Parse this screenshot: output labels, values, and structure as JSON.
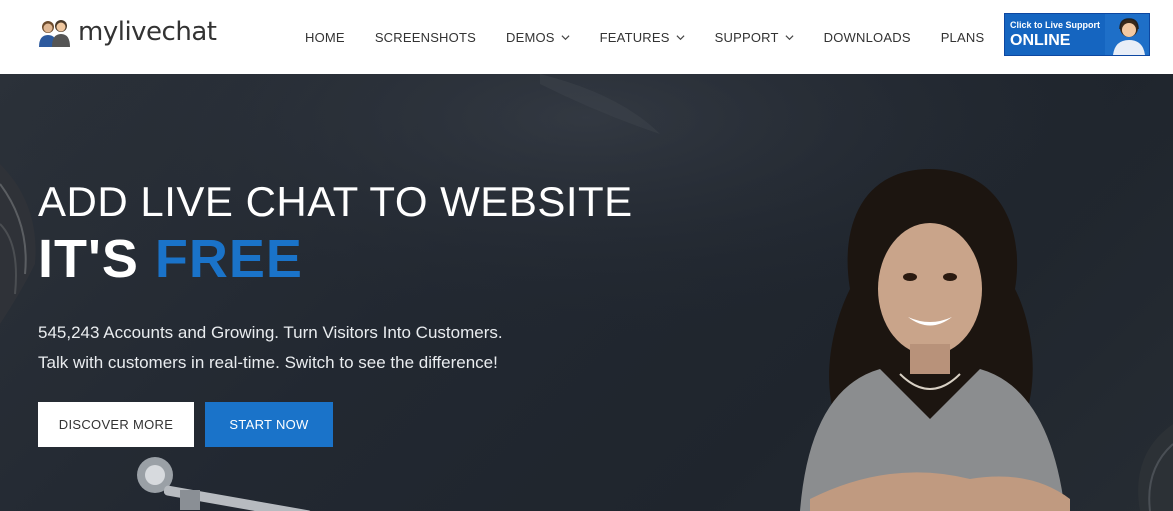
{
  "nav": {
    "logo_text": "mylivechat",
    "items": [
      {
        "label": "HOME",
        "has_dropdown": false
      },
      {
        "label": "SCREENSHOTS",
        "has_dropdown": false
      },
      {
        "label": "DEMOS",
        "has_dropdown": true
      },
      {
        "label": "FEATURES",
        "has_dropdown": true
      },
      {
        "label": "SUPPORT",
        "has_dropdown": true
      },
      {
        "label": "DOWNLOADS",
        "has_dropdown": false
      },
      {
        "label": "PLANS",
        "has_dropdown": false
      }
    ],
    "support_badge": {
      "line1": "Click to Live Support",
      "line2": "ONLINE"
    }
  },
  "hero": {
    "headline_line1": "ADD LIVE CHAT TO WEBSITE",
    "headline_part1": "IT'S",
    "headline_highlight": "FREE",
    "subtitle_line1": "545,243 Accounts and Growing. Turn Visitors Into Customers.",
    "subtitle_line2": "Talk with customers in real-time. Switch to see the difference!",
    "discover_label": "DISCOVER MORE",
    "start_label": "START NOW"
  },
  "colors": {
    "accent": "#1a73c9",
    "hero_bg": "#252b33",
    "nav_bg": "#ffffff"
  },
  "icons": [
    "logo-people-icon",
    "chevron-down-icon",
    "support-agent-icon"
  ]
}
